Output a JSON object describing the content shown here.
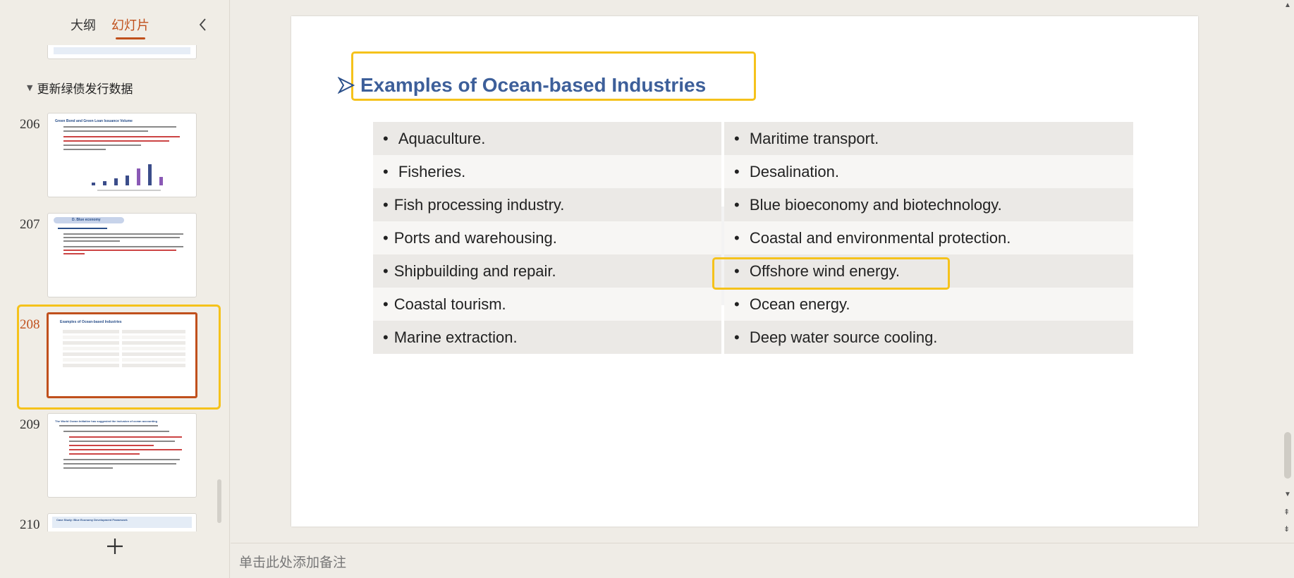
{
  "panel": {
    "tab_outline": "大纲",
    "tab_slides": "幻灯片",
    "section_title": "更新绿债发行数据",
    "add_slide_icon": "plus-icon",
    "collapse_icon": "chevron-left-icon"
  },
  "thumbnails": [
    {
      "num": "206",
      "title": "Green Bond and Green Loan Issuance Volume"
    },
    {
      "num": "207",
      "title": "D. Blue economy"
    },
    {
      "num": "208",
      "title": "Examples of Ocean-based Industries"
    },
    {
      "num": "209",
      "title": "The World Ocean Initiative has suggested the inclusion of ocean accounting"
    },
    {
      "num": "210",
      "title": "Case Study: Blue Economy Development Framework"
    }
  ],
  "slide": {
    "title": "Examples of Ocean-based Industries",
    "rows": [
      {
        "left": "Aquaculture.",
        "right": "Maritime transport."
      },
      {
        "left": "Fisheries.",
        "right": "Desalination."
      },
      {
        "left": "Fish processing industry.",
        "right": "Blue bioeconomy and biotechnology."
      },
      {
        "left": "Ports and warehousing.",
        "right": "Coastal and environmental protection."
      },
      {
        "left": "Shipbuilding and repair.",
        "right": "Offshore wind energy."
      },
      {
        "left": "Coastal tourism.",
        "right": "Ocean energy."
      },
      {
        "left": "Marine extraction.",
        "right": "Deep water source cooling."
      }
    ],
    "bullet": "•"
  },
  "notes": {
    "placeholder": "单击此处添加备注"
  },
  "colors": {
    "accent": "#c0501c",
    "highlight": "#f5c21b",
    "title_blue": "#3d5f9a"
  }
}
